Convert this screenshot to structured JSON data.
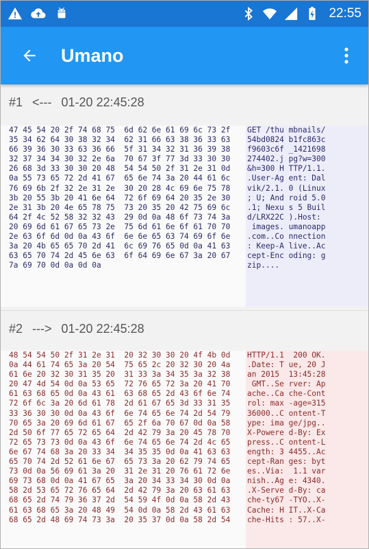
{
  "status_bar": {
    "time": "22:55",
    "icons": [
      "warning-icon",
      "cloud-upload-icon",
      "android-icon",
      "bluetooth-icon",
      "wifi-icon",
      "signal-icon",
      "battery-charging-icon"
    ]
  },
  "app_bar": {
    "title": "Umano",
    "back_icon": "arrow-back-icon",
    "menu_icon": "more-vert-icon",
    "color": "#2196f3"
  },
  "entries": [
    {
      "id": "#1",
      "direction": "<---",
      "timestamp": "01-20 22:45:28",
      "hex_lines": [
        "47 45 54 20 2f 74 68 75  6d 62 6e 61 69 6c 73 2f",
        "35 34 62 64 30 38 32 34  62 31 66 63 38 36 33 63",
        "66 39 36 30 33 63 36 66  5f 31 34 32 31 36 39 38",
        "32 37 34 34 30 32 2e 6a  70 67 3f 77 3d 33 30 30",
        "26 68 3d 33 30 30 20 48  54 54 50 2f 31 2e 31 0d",
        "0a 55 73 65 72 2d 41 67  65 6e 74 3a 20 44 61 6c",
        "76 69 6b 2f 32 2e 31 2e  30 20 28 4c 69 6e 75 78",
        "3b 20 55 3b 20 41 6e 64  72 6f 69 64 20 35 2e 30",
        "2e 31 3b 20 4e 65 78 75  73 20 35 20 42 75 69 6c",
        "64 2f 4c 52 58 32 32 43  29 0d 0a 48 6f 73 74 3a",
        "20 69 6d 61 67 65 73 2e  75 6d 61 6e 6f 61 70 70",
        "2e 63 6f 6d 0d 0a 43 6f  6e 6e 65 63 74 69 6f 6e",
        "3a 20 4b 65 65 70 2d 41  6c 69 76 65 0d 0a 41 63",
        "63 65 70 74 2d 45 6e 63  6f 64 69 6e 67 3a 20 67",
        "7a 69 70 0d 0a 0d 0a"
      ],
      "ascii_lines": [
        "GET /thu mbnails/",
        "54bd0824 b1fc863c",
        "f9603c6f _1421698",
        "274402.j pg?w=300",
        "&h=300 H TTP/1.1.",
        ".User-Ag ent: Dal",
        "vik/2.1. 0 (Linux",
        "; U; And roid 5.0",
        ".1; Nexu s 5 Buil",
        "d/LRX22C ).Host:",
        " images. umanoapp",
        ".com..Co nnection",
        ": Keep-A live..Ac",
        "cept-Enc oding: g",
        "zip...."
      ]
    },
    {
      "id": "#2",
      "direction": "--->",
      "timestamp": "01-20 22:45:28",
      "hex_lines": [
        "48 54 54 50 2f 31 2e 31  20 32 30 30 20 4f 4b 0d",
        "0a 44 61 74 65 3a 20 54  75 65 2c 20 32 30 20 4a",
        "61 6e 20 32 30 31 35 20  31 33 3a 34 35 3a 32 38",
        "20 47 4d 54 0d 0a 53 65  72 76 65 72 3a 20 41 70",
        "61 63 68 65 0d 0a 43 61  63 68 65 2d 43 6f 6e 74",
        "72 6f 6c 3a 20 6d 61 78  2d 61 67 65 3d 33 31 35",
        "33 36 30 30 0d 0a 43 6f  6e 74 65 6e 74 2d 54 79",
        "70 65 3a 20 69 6d 61 67  65 2f 6a 70 67 0d 0a 58",
        "2d 50 6f 77 65 72 65 64  2d 42 79 3a 20 45 78 70",
        "72 65 73 73 0d 0a 43 6f  6e 74 65 6e 74 2d 4c 65",
        "6e 67 74 68 3a 20 33 34  34 35 35 0d 0a 41 63 63",
        "65 70 74 2d 52 61 6e 67  65 73 3a 20 62 79 74 65",
        "73 0d 0a 56 69 61 3a 20  31 2e 31 20 76 61 72 6e",
        "69 73 68 0d 0a 41 67 65  3a 20 34 33 34 30 0d 0a",
        "58 2d 53 65 72 76 65 64  2d 42 79 3a 20 63 61 63",
        "68 65 2d 74 79 36 37 2d  54 59 4f 0d 0a 58 2d 43",
        "61 63 68 65 3a 20 48 49  54 0d 0a 58 2d 43 61 63",
        "68 65 2d 48 69 74 73 3a  20 35 37 0d 0a 58 2d 54"
      ],
      "ascii_lines": [
        "HTTP/1.1  200 OK.",
        ".Date: T ue, 20 J",
        "an 2015  13:45:28",
        " GMT..Se rver: Ap",
        "ache..Ca che-Cont",
        "rol: max -age=315",
        "36000..C ontent-T",
        "ype: ima ge/jpg..",
        "X-Powere d-By: Ex",
        "press..C ontent-L",
        "ength: 3 4455..Ac",
        "cept-Ran ges: byt",
        "es..Via:  1.1 var",
        "nish..Ag e: 4340.",
        ".X-Serve d-By: ca",
        "che-ty67 -TYO..X-",
        "Cache: H IT..X-Ca",
        "che-Hits : 57..X-"
      ]
    }
  ]
}
